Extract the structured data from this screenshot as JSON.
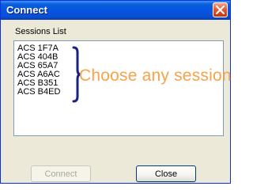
{
  "window": {
    "title": "Connect",
    "close_icon": "close-icon"
  },
  "sessions": {
    "label": "Sessions List",
    "items": [
      "ACS 1F7A",
      "ACS 404B",
      "ACS 65A7",
      "ACS A6AC",
      "ACS B351",
      "ACS B4ED"
    ]
  },
  "annotation": {
    "text": "Choose any session",
    "color": "#f8a24a",
    "brace_color": "#1a237e"
  },
  "buttons": {
    "connect_label": "Connect",
    "connect_enabled": false,
    "close_label": "Close"
  }
}
